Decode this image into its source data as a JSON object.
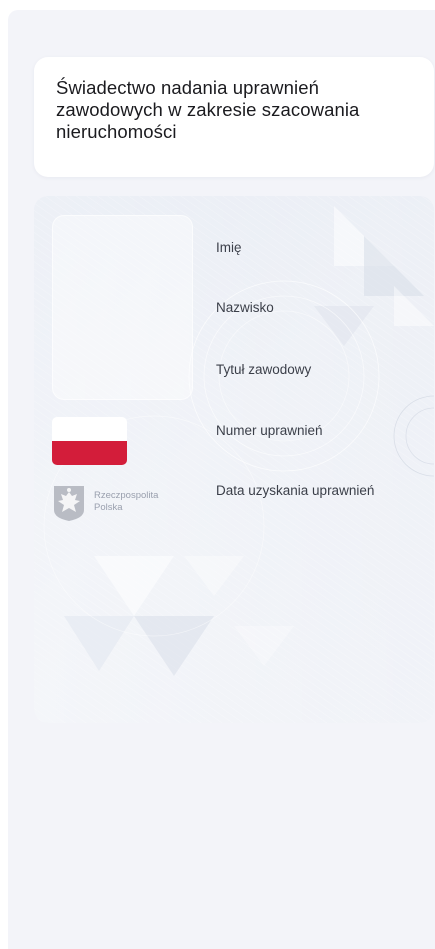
{
  "document": {
    "title": "Świadectwo nadania uprawnień zawodowych w zakresie szacowania nieruchomości"
  },
  "card": {
    "fields": [
      {
        "label": "Imię"
      },
      {
        "label": "Nazwisko"
      },
      {
        "label": "Tytuł zawodowy"
      },
      {
        "label": "Numer uprawnień"
      },
      {
        "label": "Data uzyskania uprawnień"
      }
    ],
    "issuer": {
      "line1": "Rzeczpospolita",
      "line2": "Polska"
    },
    "icons": {
      "emblem": "polish-eagle-emblem-icon",
      "flag": "polish-flag-icon"
    }
  },
  "colors": {
    "flag_red": "#d31d3a",
    "flag_white": "#ffffff",
    "background": "#f3f4f9"
  }
}
